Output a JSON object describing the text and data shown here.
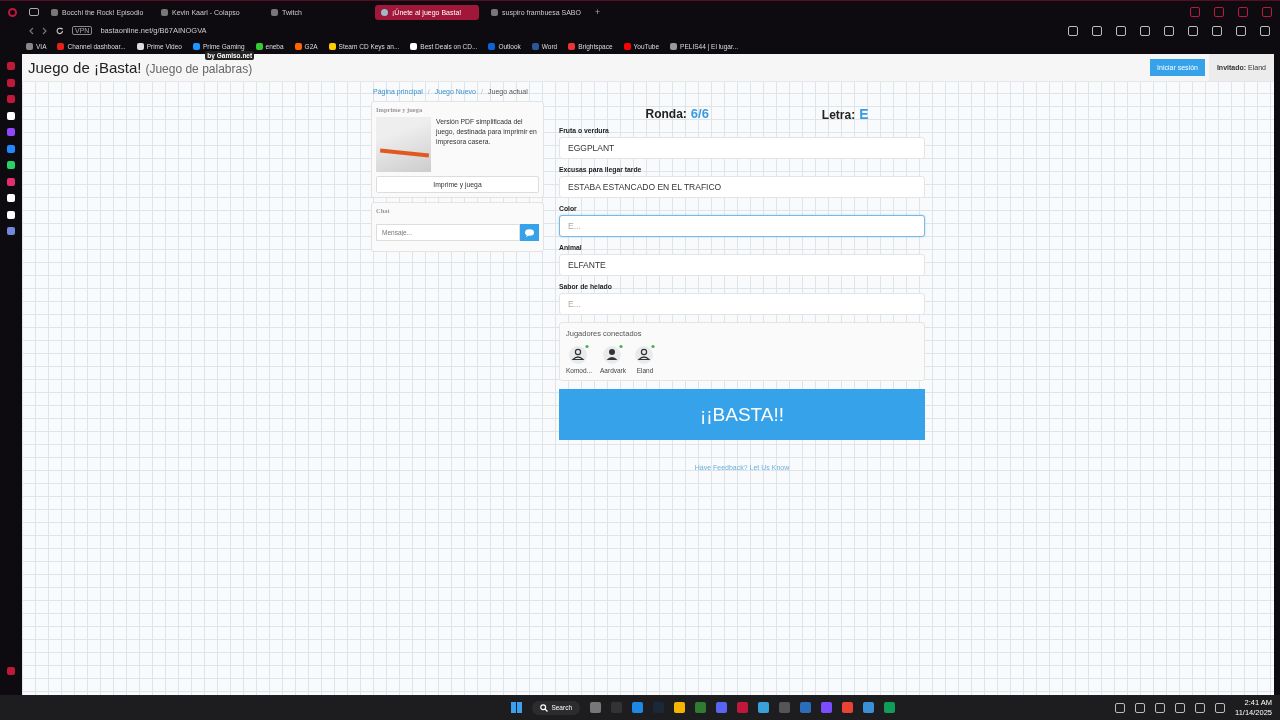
{
  "browser": {
    "tabs": [
      {
        "title": "Bocchi the Rock! Episodio",
        "selected": false
      },
      {
        "title": "Kevin Kaarl - Colapso",
        "selected": false
      },
      {
        "title": "Twitch",
        "selected": false
      },
      {
        "title": "¡Únete al juego Basta!",
        "selected": true
      },
      {
        "title": "suspiro frambuesa SABO",
        "selected": false
      }
    ],
    "new_tab": "+",
    "address": "bastaonline.net/g/B67AINOGVA",
    "vpn": "VPN",
    "bookmarks": [
      "VIA",
      "Channel dashboar...",
      "Prime Video",
      "Prime Gaming",
      "eneba",
      "G2A",
      "Steam CD Keys an...",
      "Best Deals on CD...",
      "Outlook",
      "Word",
      "Brightspace",
      "YouTube",
      "PELIS44 | El lugar..."
    ]
  },
  "page": {
    "title": "Juego de ¡Basta!",
    "subtitle": "(Juego de palabras)",
    "badge": "by Gamiso.net",
    "login_button": "Iniciar sesión",
    "guest_label": "Invitado:",
    "guest_name": "Eland",
    "breadcrumbs": [
      {
        "label": "Página principal",
        "current": false
      },
      {
        "separator": "/",
        "label": "Juego Nuevo",
        "current": false
      },
      {
        "separator": "/",
        "label": "Juego actual",
        "current": true
      }
    ],
    "print_card": {
      "title": "Imprime y juega",
      "description": "Versión PDF simplificada del juego, destinada para imprimir en impresora casera.",
      "button": "Imprime y juega"
    },
    "chat": {
      "title": "Chat",
      "placeholder": "Mensaje..."
    },
    "round_label": "Ronda:",
    "round": "6/6",
    "letter_label": "Letra:",
    "letter": "E",
    "fields": [
      {
        "label": "Fruta o verdura",
        "value": "EGGPLANT",
        "focused": false
      },
      {
        "label": "Excusas para llegar tarde",
        "value": "ESTABA ESTANCADO EN EL TRAFICO",
        "focused": false
      },
      {
        "label": "Color",
        "placeholder": "E...",
        "focused": true
      },
      {
        "label": "Animal",
        "value": "ELFANTE",
        "focused": false
      },
      {
        "label": "Sabor de helado",
        "placeholder": "E...",
        "focused": false
      }
    ],
    "players_title": "Jugadores conectados",
    "players": [
      {
        "name": "Komod...",
        "kind": "outline"
      },
      {
        "name": "Aardvark",
        "kind": "filled"
      },
      {
        "name": "Eland",
        "kind": "outline"
      }
    ],
    "basta_button": "¡¡BASTA!!",
    "feedback_link": "Have Feedback? Let Us Know"
  },
  "taskbar": {
    "search": "Search",
    "time": "2:41 AM",
    "date": "11/14/2025"
  }
}
